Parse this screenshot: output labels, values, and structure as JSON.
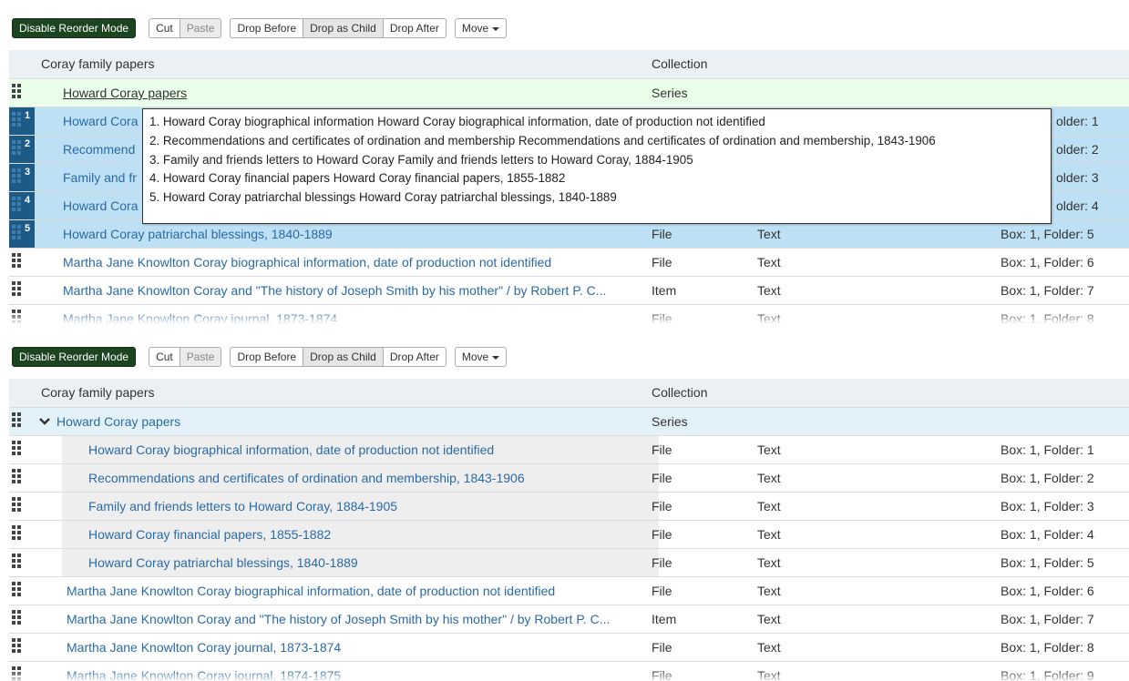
{
  "toolbar": {
    "disable_reorder": "Disable Reorder Mode",
    "cut": "Cut",
    "paste": "Paste",
    "drop_before": "Drop Before",
    "drop_as_child": "Drop as Child",
    "drop_after": "Drop After",
    "move": "Move"
  },
  "tree": {
    "root": {
      "title": "Coray family papers",
      "level": "Collection"
    },
    "series": {
      "title": "Howard Coray papers",
      "level": "Series"
    },
    "children": [
      {
        "title": "Howard Coray biographical information, date of production not identified",
        "level": "File",
        "type": "Text",
        "container": "Box: 1, Folder: 1"
      },
      {
        "title": "Recommendations and certificates of ordination and membership, 1843-1906",
        "level": "File",
        "type": "Text",
        "container": "Box: 1, Folder: 2"
      },
      {
        "title": "Family and friends letters to Howard Coray, 1884-1905",
        "level": "File",
        "type": "Text",
        "container": "Box: 1, Folder: 3"
      },
      {
        "title": "Howard Coray financial papers, 1855-1882",
        "level": "File",
        "type": "Text",
        "container": "Box: 1, Folder: 4"
      },
      {
        "title": "Howard Coray patriarchal blessings, 1840-1889",
        "level": "File",
        "type": "Text",
        "container": "Box: 1, Folder: 5"
      }
    ],
    "others": [
      {
        "title": "Martha Jane Knowlton Coray biographical information, date of production not identified",
        "level": "File",
        "type": "Text",
        "container": "Box: 1, Folder: 6"
      },
      {
        "title": "Martha Jane Knowlton Coray and \"The history of Joseph Smith by his mother\" / by Robert P. C...",
        "level": "Item",
        "type": "Text",
        "container": "Box: 1, Folder: 7"
      },
      {
        "title": "Martha Jane Knowlton Coray journal, 1873-1874",
        "level": "File",
        "type": "Text",
        "container": "Box: 1, Folder: 8"
      },
      {
        "title": "Martha Jane Knowlton Coray journal, 1874-1875",
        "level": "File",
        "type": "Text",
        "container": "Box: 1, Folder: 9"
      }
    ]
  },
  "panel1": {
    "selected_numbers": [
      "1",
      "2",
      "3",
      "4",
      "5"
    ],
    "truncated_titles": [
      "Howard Cora",
      "Recommend",
      "Family and fr",
      "Howard Cora"
    ],
    "truncated_containers": [
      "older: 1",
      "older: 2",
      "older: 3",
      "older: 4"
    ],
    "drag_popup": [
      "1. Howard Coray biographical information Howard Coray biographical information, date of production not identified",
      "2. Recommendations and certificates of ordination and membership Recommendations and certificates of ordination and membership, 1843-1906",
      "3. Family and friends letters to Howard Coray Family and friends letters to Howard Coray, 1884-1905",
      "4. Howard Coray financial papers Howard Coray financial papers, 1855-1882",
      "5. Howard Coray patriarchal blessings Howard Coray patriarchal blessings, 1840-1889"
    ]
  },
  "colors": {
    "primary_button": "#1d4420",
    "selection": "#bde0f5",
    "selected_grip": "#1e5a86",
    "link": "#2a6aa5",
    "drop_target": "#eaffea"
  },
  "icons": {
    "drag_handle": "grip-dots-icon",
    "expand": "chevron-down-icon",
    "dropdown": "caret-down-icon"
  }
}
